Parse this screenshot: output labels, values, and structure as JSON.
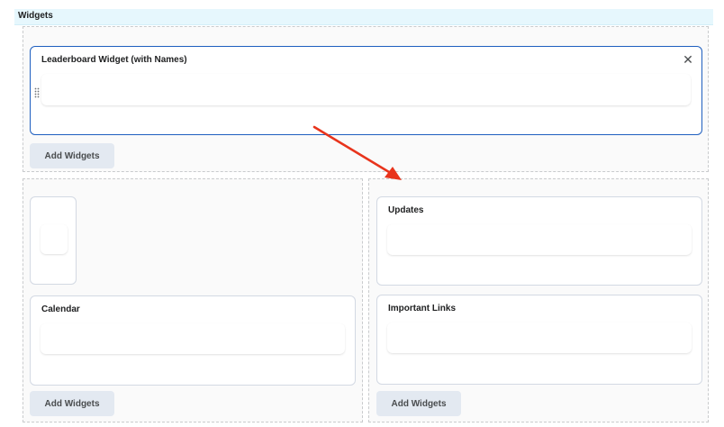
{
  "header": {
    "title": "Widgets"
  },
  "zones": {
    "top": {
      "widgets": [
        {
          "title": "Leaderboard Widget (with Names)",
          "selected": true
        }
      ],
      "add_label": "Add Widgets"
    },
    "left": {
      "widgets": [
        {
          "title": ""
        },
        {
          "title": "Calendar"
        }
      ],
      "add_label": "Add Widgets"
    },
    "right": {
      "widgets": [
        {
          "title": "Updates"
        },
        {
          "title": "Important Links"
        }
      ],
      "add_label": "Add Widgets"
    }
  },
  "annotation": {
    "arrow_color": "#e8341c"
  },
  "colors": {
    "selected_border": "#1e5fbf",
    "header_bg": "#e6f7fd",
    "button_bg": "#e3e9f1"
  }
}
